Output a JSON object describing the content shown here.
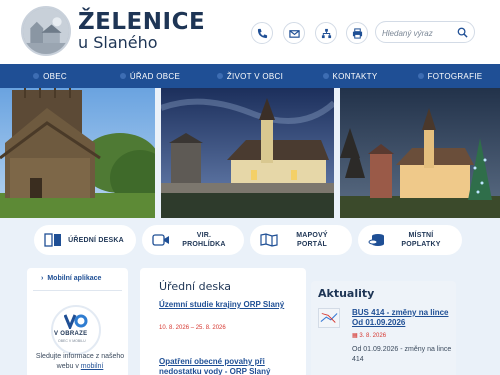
{
  "header": {
    "title": "ŽELENICE",
    "subtitle": "u Slaného",
    "search_placeholder": "Hledaný výraz"
  },
  "nav": [
    {
      "label": "OBEC"
    },
    {
      "label": "ÚŘAD OBCE"
    },
    {
      "label": "ŽIVOT V OBCI"
    },
    {
      "label": "KONTAKTY"
    },
    {
      "label": "FOTOGRAFIE"
    }
  ],
  "quick_links": [
    {
      "label": "ÚŘEDNÍ DESKA",
      "icon": "book-icon"
    },
    {
      "label": "VIR.\nPROHLÍDKA",
      "icon": "video-icon"
    },
    {
      "label": "MAPOVÝ\nPORTÁL",
      "icon": "map-icon"
    },
    {
      "label": "MÍSTNÍ\nPOPLATKY",
      "icon": "coins-icon"
    }
  ],
  "sidebar": {
    "link": "Mobilní aplikace",
    "app_title": "V OBRAZE",
    "app_sub": "OBEC V MOBILU",
    "text_a": "Sledujte informace z našeho webu v ",
    "text_link": "mobilní"
  },
  "official_board": {
    "title": "Úřední deska",
    "items": [
      {
        "title": "Územní studie krajiny ORP Slaný",
        "dates": "10. 8. 2026 – 25. 8. 2026"
      },
      {
        "title": "Opatření obecné povahy při nedostatku vody - ORP Slaný",
        "dates": ""
      }
    ]
  },
  "news": {
    "title": "Aktuality",
    "items": [
      {
        "title": "BUS 414 - změny na lince Od 01.09.2026",
        "date": "3. 8. 2026",
        "text": "Od 01.09.2026 - změny na lince 414"
      }
    ]
  },
  "colors": {
    "nav_bg": "#1f4f95",
    "accent_red": "#d6362f",
    "page_bg": "#eaf1f9",
    "title": "#1e3555"
  }
}
